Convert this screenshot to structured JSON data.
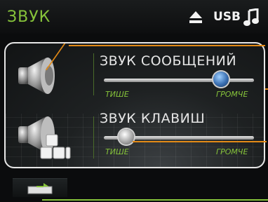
{
  "header": {
    "title": "ЗВУК",
    "usb_label": "USB"
  },
  "messages": {
    "label": "ЗВУК СООБЩЕНИЙ",
    "min_label": "ТИШЕ",
    "max_label": "ГРОМЧЕ",
    "level": 0.78
  },
  "keys": {
    "label": "ЗВУК КЛАВИШ",
    "min_label": "ТИШЕ",
    "max_label": "ГРОМЧЕ",
    "level": 0.15
  },
  "colors": {
    "accent": "#86c33a",
    "line_orange": "#e38a16",
    "panel_border": "#e6e6e6"
  },
  "icons": {
    "eject": "eject-icon",
    "usb": "usb-icon",
    "music": "music-note-icon",
    "back": "back-icon",
    "speaker": "speaker-icon",
    "keyboard": "keyboard-icon"
  }
}
